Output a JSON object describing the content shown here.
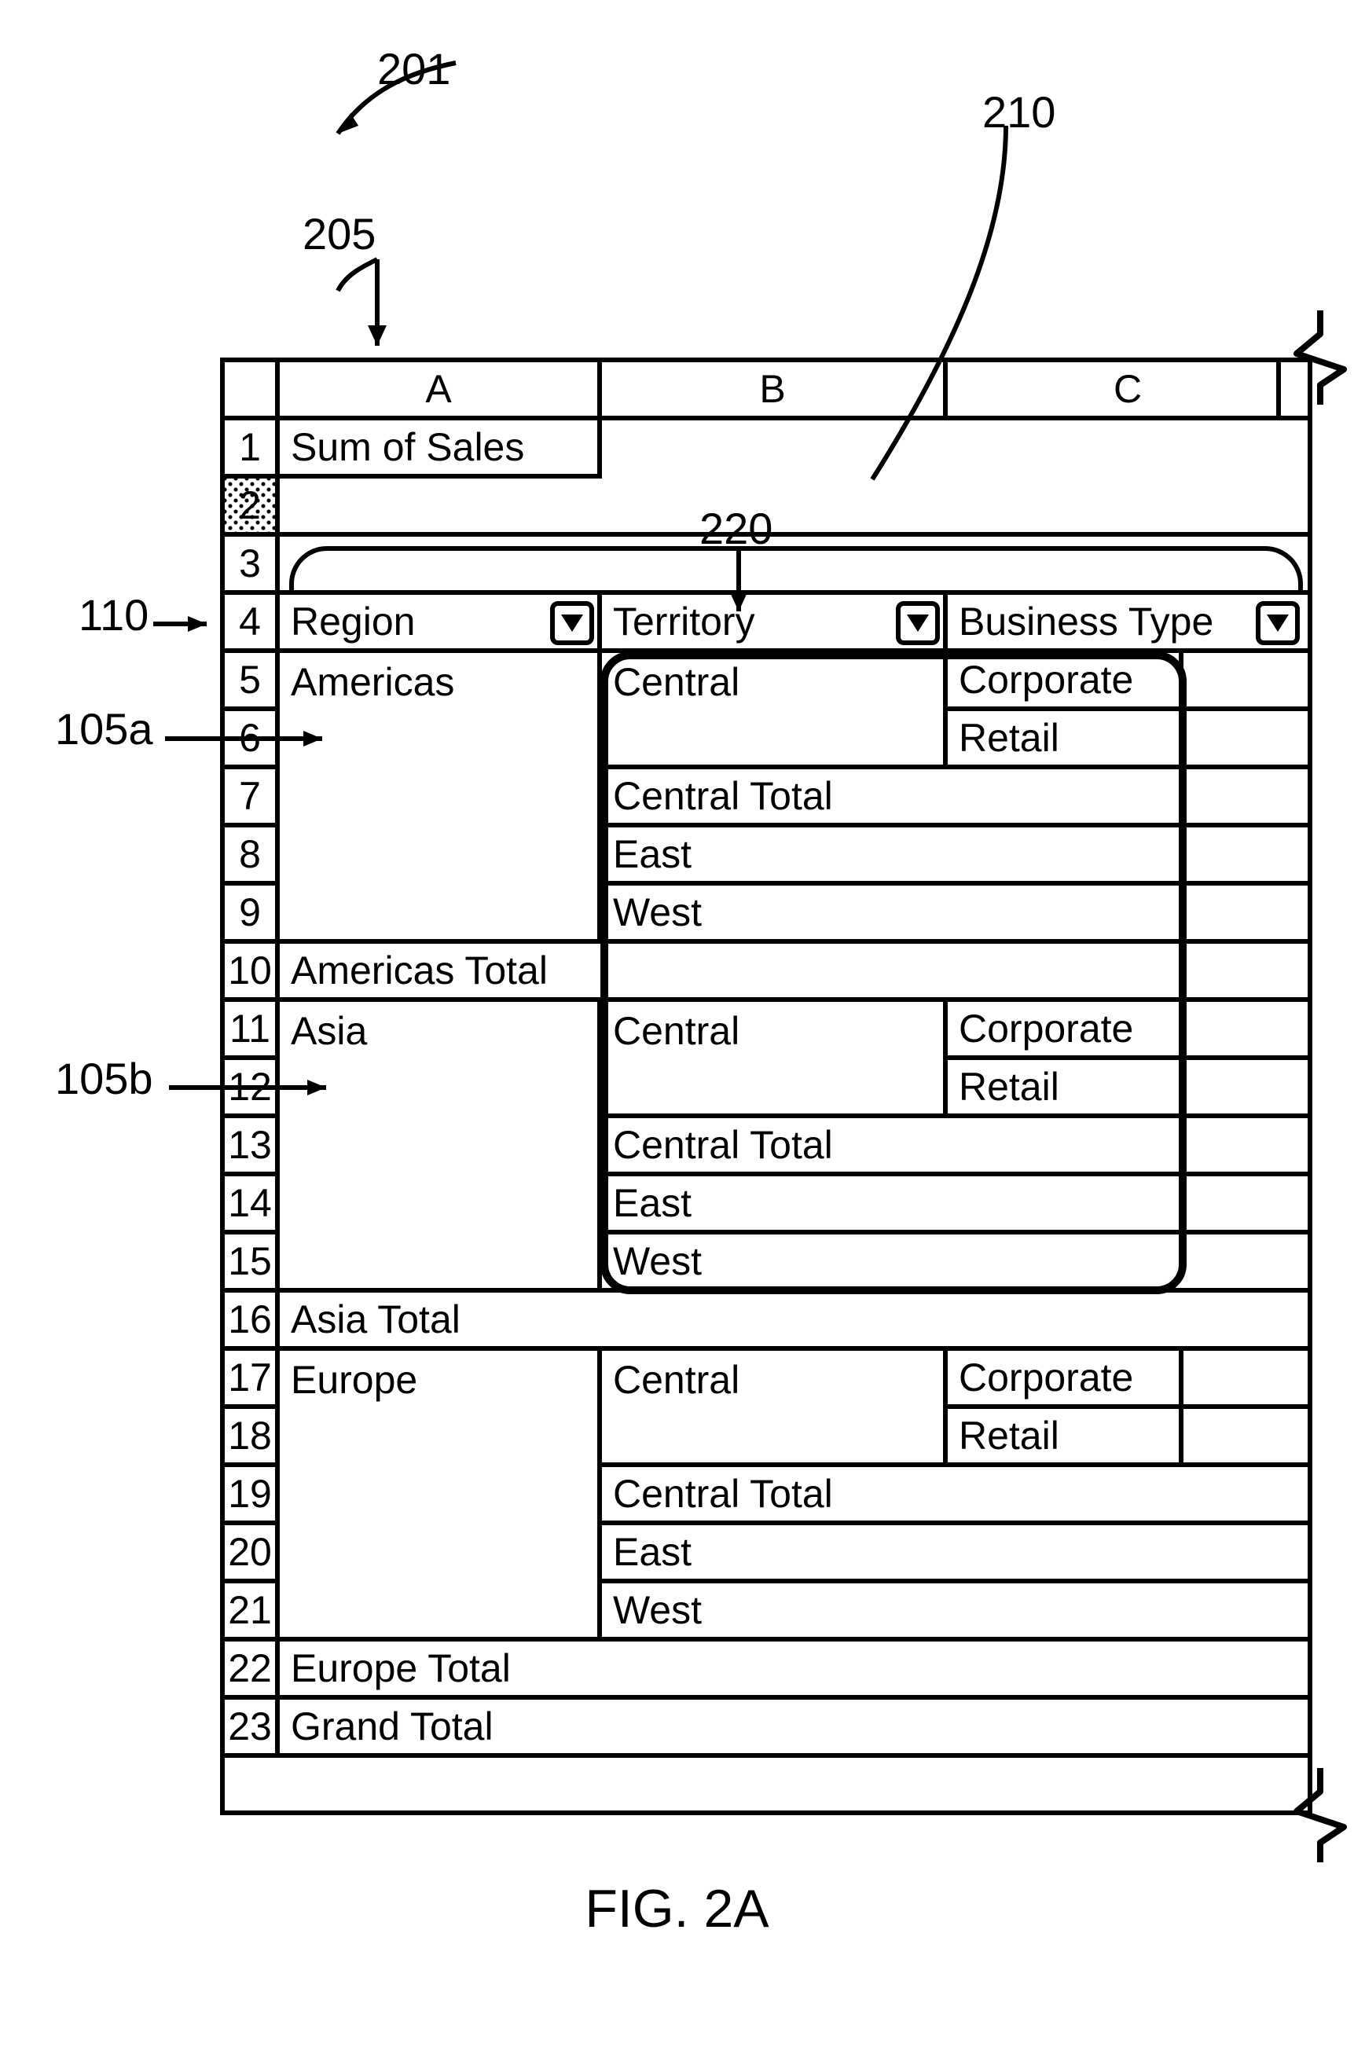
{
  "figure_caption": "FIG. 2A",
  "refs": {
    "r201": "201",
    "r205": "205",
    "r210": "210",
    "r220": "220",
    "r110": "110",
    "r105a": "105a",
    "r105b": "105b"
  },
  "sheet": {
    "columns": [
      "A",
      "B",
      "C"
    ],
    "row_numbers": [
      "1",
      "2",
      "3",
      "4",
      "5",
      "6",
      "7",
      "8",
      "9",
      "10",
      "11",
      "12",
      "13",
      "14",
      "15",
      "16",
      "17",
      "18",
      "19",
      "20",
      "21",
      "22",
      "23"
    ],
    "title_cell": "Sum of Sales",
    "field_headers": {
      "region": "Region",
      "territory": "Territory",
      "business_type": "Business Type"
    },
    "data_rows": {
      "r5": {
        "A": "Americas",
        "B": "Central",
        "C": "Corporate"
      },
      "r6": {
        "A": "",
        "B": "",
        "C": "Retail"
      },
      "r7": {
        "A": "",
        "B": "Central Total",
        "C": ""
      },
      "r8": {
        "A": "",
        "B": "East",
        "C": ""
      },
      "r9": {
        "A": "",
        "B": "West",
        "C": ""
      },
      "r10": {
        "A": "Americas Total",
        "B": "",
        "C": ""
      },
      "r11": {
        "A": "Asia",
        "B": "Central",
        "C": "Corporate"
      },
      "r12": {
        "A": "",
        "B": "",
        "C": "Retail"
      },
      "r13": {
        "A": "",
        "B": "Central Total",
        "C": ""
      },
      "r14": {
        "A": "",
        "B": "East",
        "C": ""
      },
      "r15": {
        "A": "",
        "B": "West",
        "C": ""
      },
      "r16": {
        "A": "Asia Total",
        "B": "",
        "C": ""
      },
      "r17": {
        "A": "Europe",
        "B": "Central",
        "C": "Corporate"
      },
      "r18": {
        "A": "",
        "B": "",
        "C": "Retail"
      },
      "r19": {
        "A": "",
        "B": "Central Total",
        "C": ""
      },
      "r20": {
        "A": "",
        "B": "East",
        "C": ""
      },
      "r21": {
        "A": "",
        "B": "West",
        "C": ""
      },
      "r22": {
        "A": "Europe Total",
        "B": "",
        "C": ""
      },
      "r23": {
        "A": "Grand Total",
        "B": "",
        "C": ""
      }
    }
  }
}
